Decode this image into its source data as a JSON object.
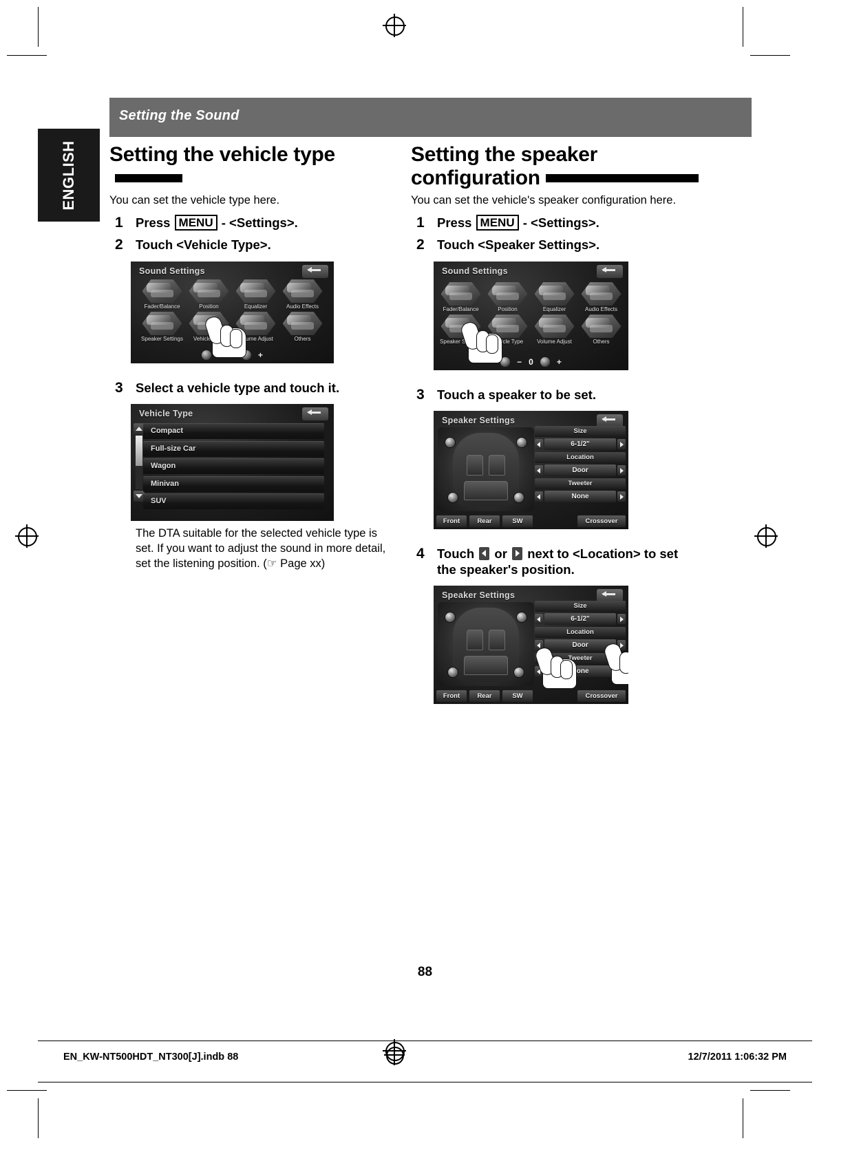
{
  "document": {
    "language_tab": "ENGLISH",
    "running_head": "Setting the Sound",
    "page_number": "88"
  },
  "footer": {
    "file_name": "EN_KW-NT500HDT_NT300[J].indb   88",
    "timestamp": "12/7/2011   1:06:32 PM"
  },
  "left_column": {
    "heading": "Setting the vehicle type",
    "lead": "You can set the vehicle type here.",
    "steps": [
      {
        "num": "1",
        "pre": "Press",
        "key": "MENU",
        "post": "- <Settings>."
      },
      {
        "num": "2",
        "text": "Touch <Vehicle Type>."
      },
      {
        "num": "3",
        "text": "Select a vehicle type and touch it."
      }
    ],
    "note": "The DTA suitable for the selected vehicle type is set. If you want to adjust the sound in more detail, set the listening position. (☞ Page xx)"
  },
  "right_column": {
    "heading_line1": "Setting the speaker",
    "heading_line2": "configuration",
    "lead": "You can set the vehicle's speaker configuration here.",
    "steps": [
      {
        "num": "1",
        "pre": "Press",
        "key": "MENU",
        "post": "- <Settings>."
      },
      {
        "num": "2",
        "text": "Touch <Speaker Settings>."
      },
      {
        "num": "3",
        "text": "Touch a speaker to be set."
      },
      {
        "num": "4",
        "pre": "Touch",
        "mid": "or",
        "post": "next to <Location> to set the speaker's position."
      }
    ]
  },
  "screens": {
    "sound_settings": {
      "title": "Sound Settings",
      "back_icon": "back-arrow-icon",
      "row1": [
        "Fader/Balance",
        "Position",
        "Equalizer",
        "Audio Effects"
      ],
      "row2": [
        "Speaker Settings",
        "Vehicle Type",
        "Volume Adjust",
        "Others"
      ],
      "volume_minus": "−",
      "volume_value": "0",
      "volume_plus": "+"
    },
    "vehicle_type": {
      "title": "Vehicle Type",
      "back_icon": "back-arrow-icon",
      "items": [
        "Compact",
        "Full-size Car",
        "Wagon",
        "Minivan",
        "SUV"
      ],
      "scroll_up_icon": "chevron-up-icon",
      "scroll_down_icon": "chevron-down-icon"
    },
    "speaker_settings": {
      "title": "Speaker Settings",
      "back_icon": "back-arrow-icon",
      "controls": [
        {
          "label": "Size",
          "value": "6-1/2\""
        },
        {
          "label": "Location",
          "value": "Door"
        },
        {
          "label": "Tweeter",
          "value": "None"
        }
      ],
      "bottom_buttons": [
        "Front",
        "Rear",
        "SW",
        "Crossover"
      ]
    }
  },
  "colors": {
    "headbar": "#6b6b6b",
    "tab": "#1a1a1a",
    "screen_bg": "#161616"
  }
}
